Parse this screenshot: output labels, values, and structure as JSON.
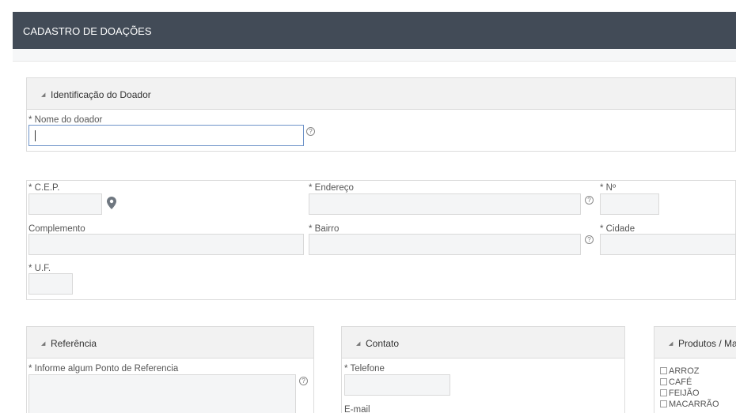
{
  "header": {
    "title": "CADASTRO DE DOAÇÕES"
  },
  "doador": {
    "section_title": "Identificação do Doador",
    "nome_label": "* Nome do doador",
    "nome_value": ""
  },
  "endereco": {
    "cep_label": "* C.E.P.",
    "endereco_label": "* Endereço",
    "numero_label": "* Nº",
    "complemento_label": "Complemento",
    "bairro_label": "* Bairro",
    "cidade_label": "* Cidade",
    "uf_label": "* U.F."
  },
  "referencia": {
    "section_title": "Referência",
    "ponto_label": "* Informe algum Ponto de Referencia"
  },
  "contato": {
    "section_title": "Contato",
    "telefone_label": "* Telefone",
    "email_label": "E-mail"
  },
  "produtos": {
    "section_title": "Produtos / Ma",
    "items": [
      "ARROZ",
      "CAFÉ",
      "FEIJÃO",
      "MACARRÃO"
    ]
  },
  "help_glyph": "?",
  "caret_glyph": "◢",
  "icons": {
    "help": "help-circle-icon",
    "location": "map-pin-icon",
    "caret": "caret-down-icon"
  },
  "colors": {
    "header_bg": "#424b57",
    "active_border": "#6e93c9",
    "pin": "#6f7780"
  }
}
